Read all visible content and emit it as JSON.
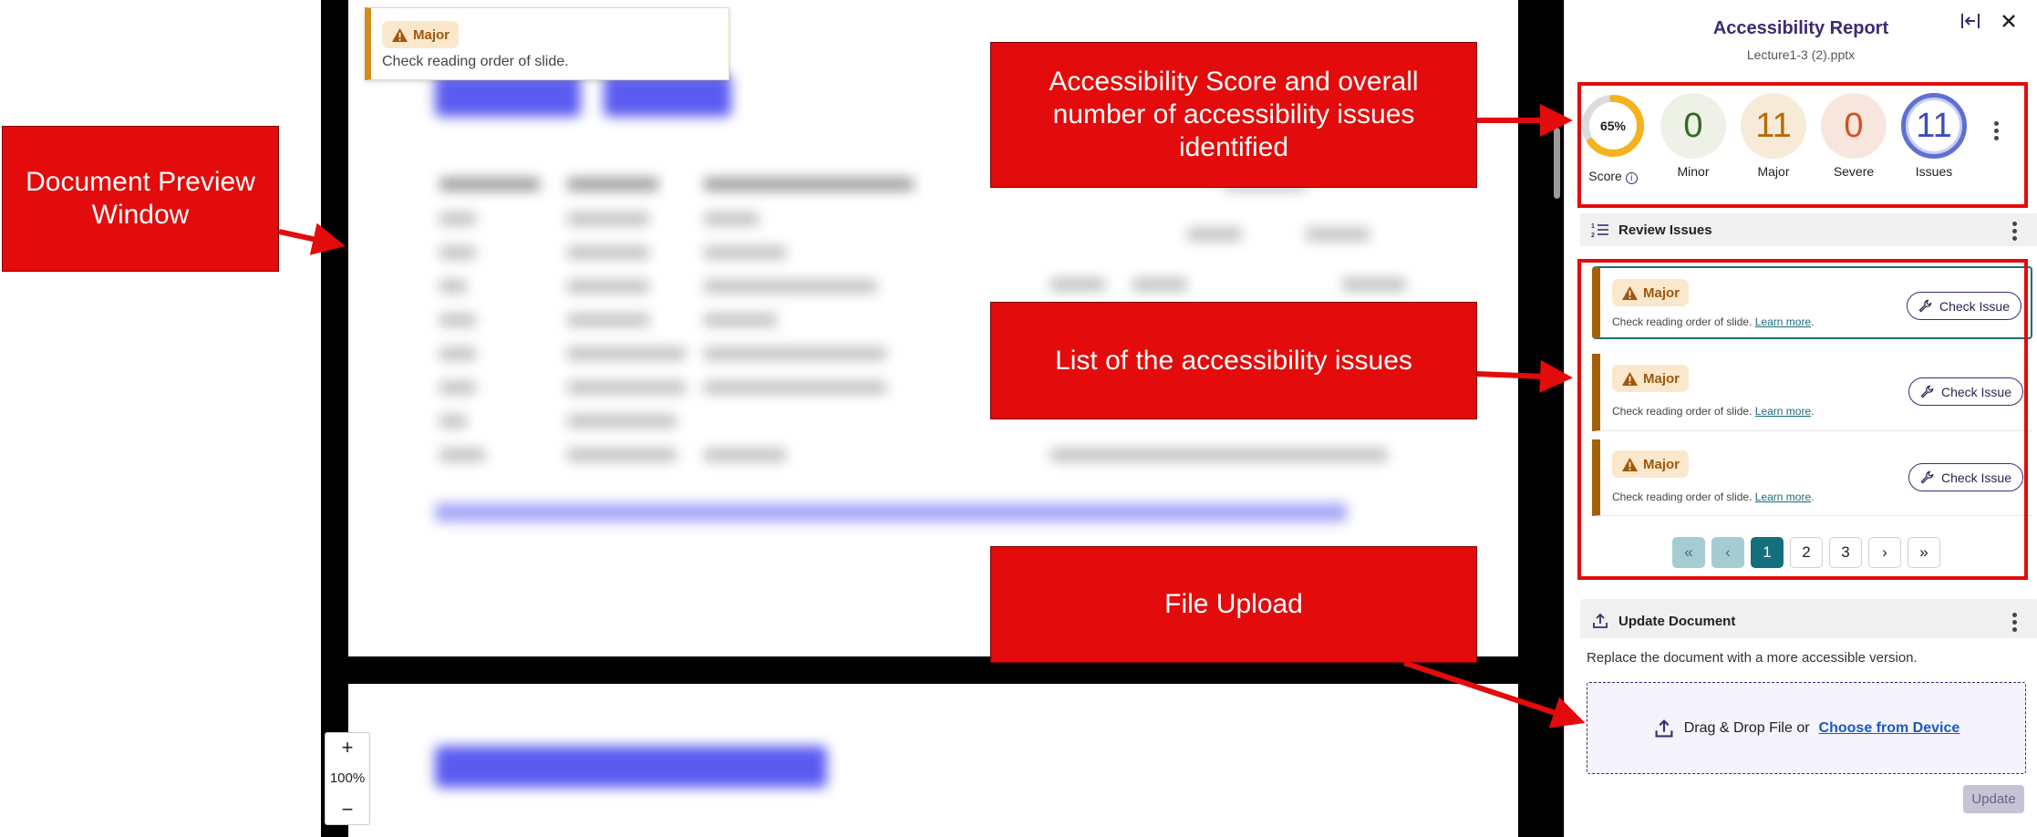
{
  "preview": {
    "tooltip": {
      "severity": "Major",
      "message": "Check reading order of slide."
    },
    "zoom": {
      "plus": "+",
      "level": "100%",
      "minus": "−"
    }
  },
  "panel": {
    "title": "Accessibility Report",
    "filename": "Lecture1-3 (2).pptx",
    "score": {
      "value": "65%",
      "fraction": 0.65,
      "label": "Score"
    },
    "stats": [
      {
        "value": "0",
        "label": "Minor",
        "color": "#2e6b1f",
        "bg": "#eef1e6"
      },
      {
        "value": "11",
        "label": "Major",
        "color": "#b76a07",
        "bg": "#f7ead6"
      },
      {
        "value": "0",
        "label": "Severe",
        "color": "#d3501f",
        "bg": "#f8e6de"
      },
      {
        "value": "11",
        "label": "Issues",
        "color": "#3a4eb8",
        "bg": "#ffffff"
      }
    ],
    "review": {
      "title": "Review Issues",
      "issues": [
        {
          "severity": "Major",
          "text": "Check reading order of slide.",
          "link": "Learn more",
          "action": "Check Issue"
        },
        {
          "severity": "Major",
          "text": "Check reading order of slide.",
          "link": "Learn more",
          "action": "Check Issue"
        },
        {
          "severity": "Major",
          "text": "Check reading order of slide.",
          "link": "Learn more",
          "action": "Check Issue"
        }
      ],
      "pagination": {
        "first": "«",
        "prev": "‹",
        "pages": [
          "1",
          "2",
          "3"
        ],
        "next": "›",
        "last": "»",
        "current": "1"
      }
    },
    "update": {
      "title": "Update Document",
      "description": "Replace the document with a more accessible version.",
      "drop_text": "Drag & Drop File or",
      "drop_link": "Choose from Device",
      "button": "Update"
    }
  },
  "annotations": {
    "preview_window": "Document Preview Window",
    "score": "Accessibility Score and overall number of accessibility issues identified",
    "issues": "List of the accessibility issues",
    "upload": "File Upload",
    "color": "#e30b0b"
  }
}
